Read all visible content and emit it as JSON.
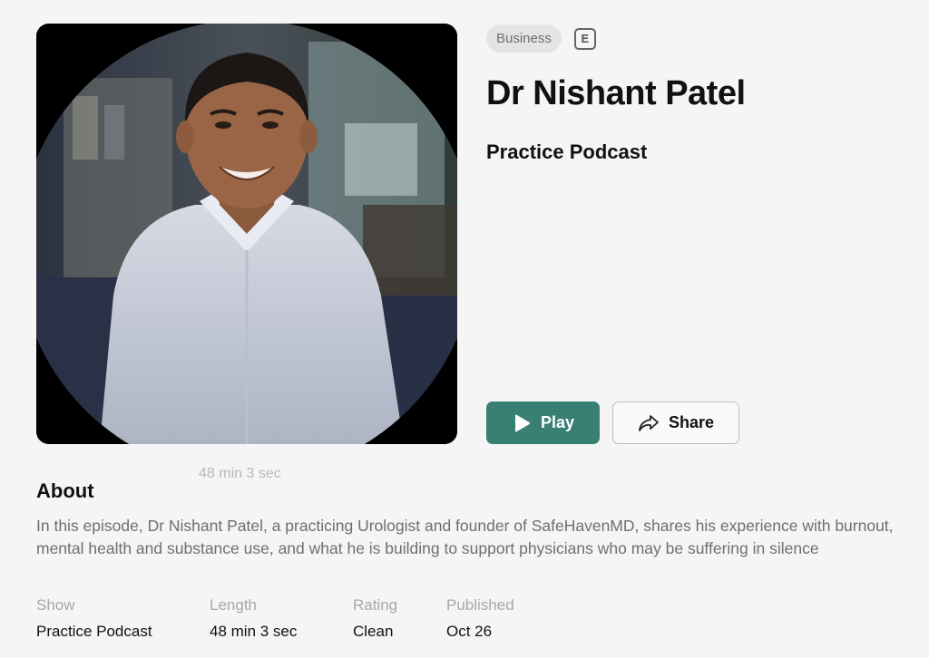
{
  "episode": {
    "genre": "Business",
    "explicit_badge": "E",
    "title": "Dr Nishant Patel",
    "show": "Practice Podcast",
    "duration_overlay": "48 min 3 sec"
  },
  "actions": {
    "play_label": "Play",
    "share_label": "Share"
  },
  "about": {
    "heading": "About",
    "description": "In this episode, Dr Nishant Patel, a practicing Urologist and founder of SafeHavenMD, shares his experience with burnout, mental health and substance use, and what he is building to support physicians who may be suffering in silence"
  },
  "meta": {
    "show_label": "Show",
    "show_value": "Practice Podcast",
    "length_label": "Length",
    "length_value": "48 min 3 sec",
    "rating_label": "Rating",
    "rating_value": "Clean",
    "published_label": "Published",
    "published_value": "Oct 26"
  },
  "icons": {
    "play": "play-icon",
    "share": "share-icon",
    "explicit": "explicit-icon"
  },
  "colors": {
    "accent": "#3a7f73",
    "background": "#f5f5f5",
    "muted_text": "#6f6f6f"
  }
}
